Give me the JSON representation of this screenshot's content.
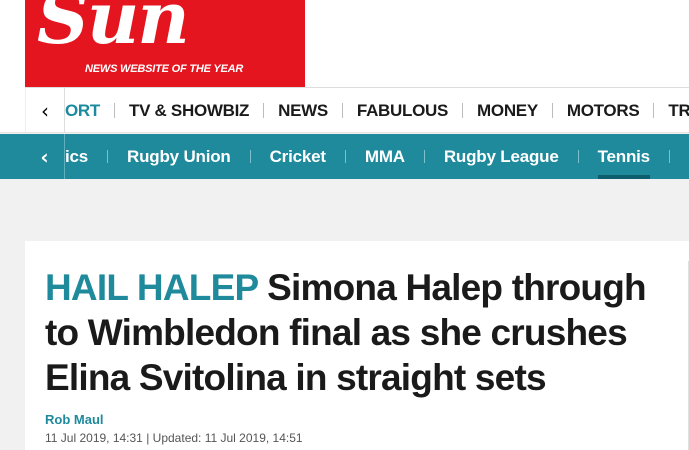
{
  "masthead": {
    "logo_text": "Sun",
    "tagline": "NEWS WEBSITE OF THE YEAR"
  },
  "main_nav": {
    "back_icon": "chevron-left-icon",
    "items": [
      {
        "label": "ORT",
        "active": true
      },
      {
        "label": "TV & SHOWBIZ"
      },
      {
        "label": "NEWS"
      },
      {
        "label": "FABULOUS"
      },
      {
        "label": "MONEY"
      },
      {
        "label": "MOTORS"
      },
      {
        "label": "TRAVEL"
      }
    ]
  },
  "sub_nav": {
    "back_icon": "chevron-left-icon",
    "items": [
      {
        "label": "ics"
      },
      {
        "label": "Rugby Union"
      },
      {
        "label": "Cricket"
      },
      {
        "label": "MMA"
      },
      {
        "label": "Rugby League"
      },
      {
        "label": "Tennis",
        "active": true
      }
    ]
  },
  "article": {
    "kicker": "HAIL HALEP",
    "headline": "Simona Halep through to Wimbledon final as she crushes Elina Svitolina in straight sets",
    "author": "Rob Maul",
    "published": "11 Jul 2019, 14:31",
    "separator": "|",
    "updated": "Updated: 11 Jul 2019, 14:51"
  },
  "colors": {
    "brand_red": "#e4151f",
    "accent_teal": "#1e8a9c"
  }
}
